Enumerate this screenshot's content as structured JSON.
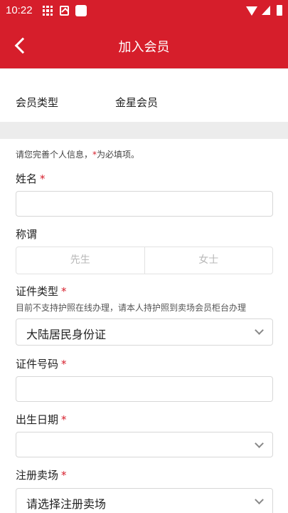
{
  "status_bar": {
    "time": "10:22",
    "icons": [
      "grid-icon",
      "app-a-icon",
      "square-icon",
      "wifi-icon",
      "signal-icon",
      "battery-icon"
    ]
  },
  "header": {
    "title": "加入会员",
    "back_icon": "chevron-left-icon",
    "background_color": "#d61e2b"
  },
  "member_type": {
    "label": "会员类型",
    "value": "金星会员"
  },
  "notice": {
    "prefix": "请您完善个人信息，",
    "star": "*",
    "suffix": "为必填项。"
  },
  "form": {
    "name": {
      "label": "姓名",
      "required": "*",
      "value": ""
    },
    "salutation": {
      "label": "称谓",
      "options": [
        "先生",
        "女士"
      ]
    },
    "id_type": {
      "label": "证件类型",
      "required": "*",
      "hint": "目前不支持护照在线办理，请本人持护照到卖场会员柜台办理",
      "value": "大陆居民身份证"
    },
    "id_number": {
      "label": "证件号码",
      "required": "*",
      "value": ""
    },
    "birthday": {
      "label": "出生日期",
      "required": "*",
      "value": ""
    },
    "store": {
      "label": "注册卖场",
      "required": "*",
      "value": "请选择注册卖场"
    }
  }
}
